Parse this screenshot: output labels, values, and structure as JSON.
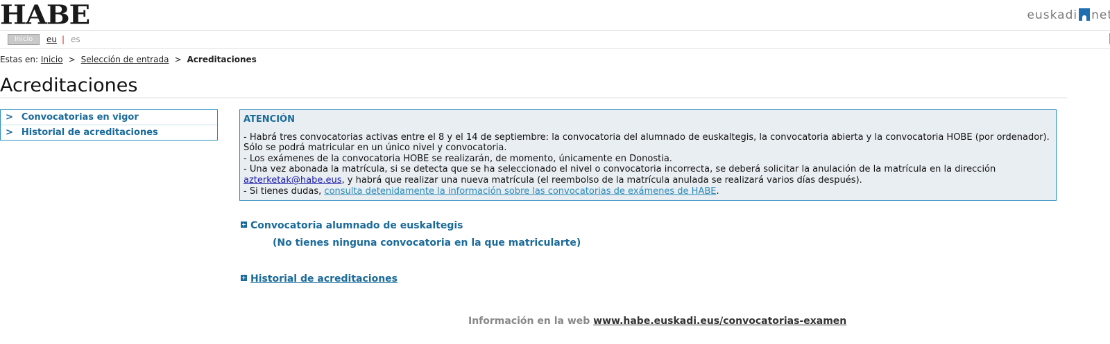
{
  "header": {
    "logo": "HABE",
    "portal_left": "euskadi",
    "portal_right": "net"
  },
  "subbar": {
    "home_button": "Inicio",
    "lang_current": "eu",
    "lang_separator": "|",
    "lang_other": "es"
  },
  "breadcrumb": {
    "prefix": "Estas en:",
    "items": [
      "Inicio",
      "Selección de entrada",
      "Acreditaciones"
    ],
    "separator": ">"
  },
  "page": {
    "title": "Acreditaciones"
  },
  "sidebar": {
    "items": [
      {
        "arrow": ">",
        "label": "Convocatorias en vigor"
      },
      {
        "arrow": ">",
        "label": "Historial de acreditaciones"
      }
    ]
  },
  "notice": {
    "title": "ATENCIÓN",
    "line1": "- Habrá tres convocatorias activas entre el 8 y el 14 de septiembre: la convocatoria del alumnado de euskaltegis, la convocatoria abierta y la convocatoria HOBE (por ordenador). Sólo se podrá matricular en un único nivel y convocatoria.",
    "line2": "- Los exámenes de la convocatoria HOBE se realizarán, de momento, únicamente en Donostia.",
    "line3_a": "- Una vez abonada la matrícula, si se detecta que se ha seleccionado el nivel o convocatoria incorrecta, se deberá solicitar la anulación de la matrícula en la dirección ",
    "line3_email": "azterketak@habe.eus",
    "line3_b": ", y habrá que realizar una nueva matrícula (el reembolso de la matrícula anulada se realizará varios días después).",
    "line4_a": "- Si tienes dudas, ",
    "line4_link": "consulta detenidamente la información sobre las convocatorias de exámenes de HABE",
    "line4_b": "."
  },
  "sections": {
    "euskaltegi_title": "Convocatoria alumnado de euskaltegis",
    "euskaltegi_empty": "(No tienes ninguna convocatoria en la que matricularte)",
    "history_title": "Historial de acreditaciones"
  },
  "footer": {
    "info_label": "Información en la web",
    "info_link": "www.habe.euskadi.eus/convocatorias-examen"
  },
  "colors": {
    "accent": "#1a6a9a",
    "notice_bg": "#e9eef2",
    "border": "#2b8cbf"
  }
}
